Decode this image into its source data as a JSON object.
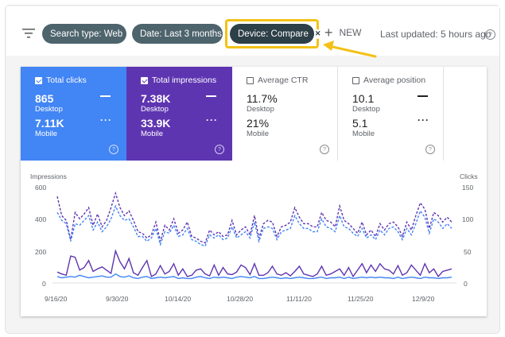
{
  "toolbar": {
    "filters": [
      {
        "label": "Search type: Web"
      },
      {
        "label": "Date: Last 3 months"
      },
      {
        "label": "Device: Compare"
      }
    ],
    "new_label": "NEW",
    "last_updated": "Last updated: 5 hours ago",
    "help_glyph": "?"
  },
  "highlight_color": "#f3c117",
  "metrics": [
    {
      "title": "Total clicks",
      "checked": true,
      "primary_value": "865",
      "primary_label": "Desktop",
      "secondary_value": "7.11K",
      "secondary_label": "Mobile",
      "color": "#4285f4"
    },
    {
      "title": "Total impressions",
      "checked": true,
      "primary_value": "7.38K",
      "primary_label": "Desktop",
      "secondary_value": "33.9K",
      "secondary_label": "Mobile",
      "color": "#5e35b1"
    },
    {
      "title": "Average CTR",
      "checked": false,
      "primary_value": "11.7%",
      "primary_label": "Desktop",
      "secondary_value": "21%",
      "secondary_label": "Mobile",
      "color": "#ffffff"
    },
    {
      "title": "Average position",
      "checked": false,
      "primary_value": "10.1",
      "primary_label": "Desktop",
      "secondary_value": "5.1",
      "secondary_label": "Mobile",
      "color": "#ffffff"
    }
  ],
  "chart_data": {
    "type": "line",
    "left_axis_title": "Impressions",
    "right_axis_title": "Clicks",
    "left_ticks": [
      "600",
      "400",
      "200",
      "0"
    ],
    "right_ticks": [
      "150",
      "100",
      "50",
      "0"
    ],
    "ylim_left": [
      0,
      600
    ],
    "ylim_right": [
      0,
      150
    ],
    "x_tick_labels": [
      "9/16/20",
      "9/30/20",
      "10/14/20",
      "10/28/20",
      "11/11/20",
      "11/25/20",
      "12/9/20"
    ],
    "series": [
      {
        "metric": "Impressions",
        "device": "Mobile",
        "style": "dashed",
        "color": "#5e35b1",
        "values": [
          540,
          420,
          390,
          270,
          440,
          400,
          430,
          470,
          360,
          430,
          350,
          390,
          470,
          560,
          470,
          420,
          450,
          390,
          320,
          310,
          280,
          300,
          380,
          260,
          360,
          330,
          400,
          310,
          330,
          380,
          290,
          280,
          260,
          250,
          330,
          300,
          320,
          290,
          300,
          390,
          300,
          330,
          350,
          300,
          420,
          280,
          370,
          390,
          380,
          290,
          350,
          360,
          380,
          470,
          410,
          370,
          370,
          350,
          350,
          440,
          390,
          380,
          350,
          480,
          390,
          370,
          340,
          310,
          380,
          300,
          330,
          290,
          370,
          330,
          370,
          380,
          350,
          290,
          380,
          330,
          420,
          500,
          460,
          340,
          440,
          420,
          380,
          410,
          380
        ]
      },
      {
        "metric": "Impressions",
        "device": "Desktop",
        "style": "dashed",
        "color": "#4285f4",
        "values": [
          440,
          390,
          370,
          260,
          370,
          360,
          390,
          420,
          330,
          380,
          320,
          350,
          400,
          480,
          420,
          390,
          400,
          350,
          290,
          290,
          260,
          280,
          340,
          240,
          320,
          310,
          360,
          290,
          300,
          340,
          270,
          260,
          240,
          230,
          300,
          280,
          300,
          270,
          280,
          350,
          280,
          300,
          320,
          280,
          380,
          260,
          340,
          350,
          340,
          270,
          320,
          330,
          340,
          420,
          370,
          340,
          340,
          320,
          320,
          400,
          350,
          340,
          320,
          420,
          350,
          340,
          310,
          290,
          340,
          280,
          300,
          270,
          330,
          300,
          340,
          350,
          320,
          270,
          340,
          300,
          370,
          450,
          410,
          310,
          400,
          380,
          340,
          370,
          340
        ]
      },
      {
        "metric": "Clicks",
        "device": "Mobile",
        "style": "solid",
        "color": "#5e35b1",
        "values": [
          17,
          14,
          12,
          42,
          40,
          20,
          24,
          35,
          18,
          22,
          25,
          20,
          15,
          50,
          33,
          22,
          38,
          16,
          12,
          24,
          35,
          10,
          14,
          27,
          14,
          18,
          30,
          12,
          22,
          10,
          12,
          20,
          22,
          14,
          11,
          28,
          12,
          24,
          14,
          13,
          17,
          28,
          24,
          13,
          30,
          12,
          12,
          16,
          26,
          14,
          12,
          16,
          11,
          18,
          26,
          14,
          12,
          10,
          14,
          26,
          12,
          14,
          18,
          22,
          12,
          24,
          10,
          20,
          30,
          16,
          28,
          18,
          30,
          22,
          20,
          14,
          27,
          12,
          16,
          28,
          20,
          12,
          30,
          16,
          22,
          10,
          18,
          20,
          22
        ]
      },
      {
        "metric": "Clicks",
        "device": "Desktop",
        "style": "solid",
        "color": "#4285f4",
        "values": [
          10,
          8,
          9,
          10,
          9,
          12,
          10,
          8,
          9,
          10,
          11,
          9,
          9,
          14,
          10,
          9,
          11,
          8,
          7,
          9,
          10,
          7,
          8,
          9,
          8,
          9,
          10,
          7,
          8,
          7,
          7,
          9,
          10,
          8,
          7,
          9,
          8,
          9,
          8,
          7,
          9,
          10,
          9,
          8,
          10,
          7,
          7,
          8,
          9,
          8,
          7,
          8,
          7,
          8,
          9,
          8,
          7,
          7,
          8,
          9,
          7,
          8,
          8,
          9,
          7,
          9,
          7,
          8,
          9,
          8,
          9,
          8,
          9,
          8,
          8,
          7,
          9,
          7,
          8,
          9,
          8,
          7,
          9,
          8,
          8,
          7,
          8,
          8,
          9
        ]
      }
    ]
  }
}
